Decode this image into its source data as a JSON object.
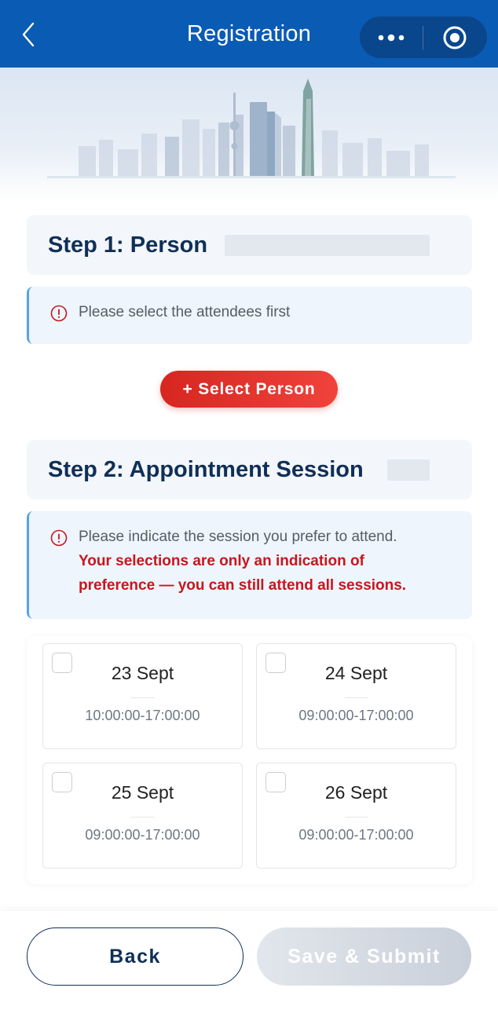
{
  "header": {
    "title": "Registration",
    "back_icon": "chevron-left-icon",
    "more_icon": "more-dots-icon",
    "target_icon": "record-target-icon"
  },
  "banner": {
    "illustration": "city-skyline"
  },
  "step1": {
    "title": "Step 1: Person",
    "notice": "Please select the attendees first",
    "select_button": "+ Select Person"
  },
  "step2": {
    "title": "Step 2: Appointment Session",
    "notice": "Please indicate the session you prefer to attend.",
    "notice_highlight_1": "Your selections are only an indication of",
    "notice_highlight_2": "preference — you can still attend all sessions."
  },
  "sessions": [
    {
      "date": "23 Sept",
      "time": "10:00:00-17:00:00",
      "checked": false
    },
    {
      "date": "24 Sept",
      "time": "09:00:00-17:00:00",
      "checked": false
    },
    {
      "date": "25 Sept",
      "time": "09:00:00-17:00:00",
      "checked": false
    },
    {
      "date": "26 Sept",
      "time": "09:00:00-17:00:00",
      "checked": false
    }
  ],
  "footer": {
    "back_label": "Back",
    "submit_label": "Save & Submit"
  },
  "colors": {
    "header_blue": "#0a5bb4",
    "title_navy": "#0f2f57",
    "accent_red": "#d6261f",
    "notice_bg": "#eef5fc",
    "notice_border": "#55a6dc"
  }
}
